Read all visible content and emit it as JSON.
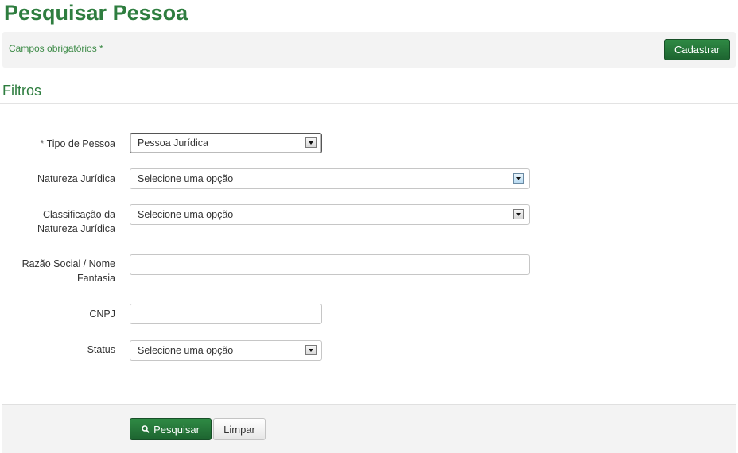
{
  "page": {
    "title": "Pesquisar Pessoa"
  },
  "info_bar": {
    "required_note": "Campos obrigatórios *",
    "register_button": "Cadastrar"
  },
  "filters": {
    "section_title": "Filtros",
    "tipo_pessoa": {
      "required_mark": "*",
      "label": "Tipo de Pessoa",
      "value": "Pessoa Jurídica"
    },
    "natureza_juridica": {
      "label": "Natureza Jurídica",
      "value": "Selecione uma opção"
    },
    "classificacao": {
      "label_line1": "Classificação da",
      "label_line2": "Natureza Jurídica",
      "value": "Selecione uma opção"
    },
    "razao_social": {
      "label_line1": "Razão Social / Nome",
      "label_line2": "Fantasia",
      "value": ""
    },
    "cnpj": {
      "label": "CNPJ",
      "value": ""
    },
    "status": {
      "label": "Status",
      "value": "Selecione uma opção"
    }
  },
  "footer": {
    "search_button": "Pesquisar",
    "clear_button": "Limpar"
  },
  "icons": {
    "search": "search-icon",
    "dropdown": "chevron-down-icon"
  },
  "colors": {
    "brand_green": "#2e7d3f",
    "button_green": "#1d6430",
    "panel_gray": "#f3f3f3"
  }
}
